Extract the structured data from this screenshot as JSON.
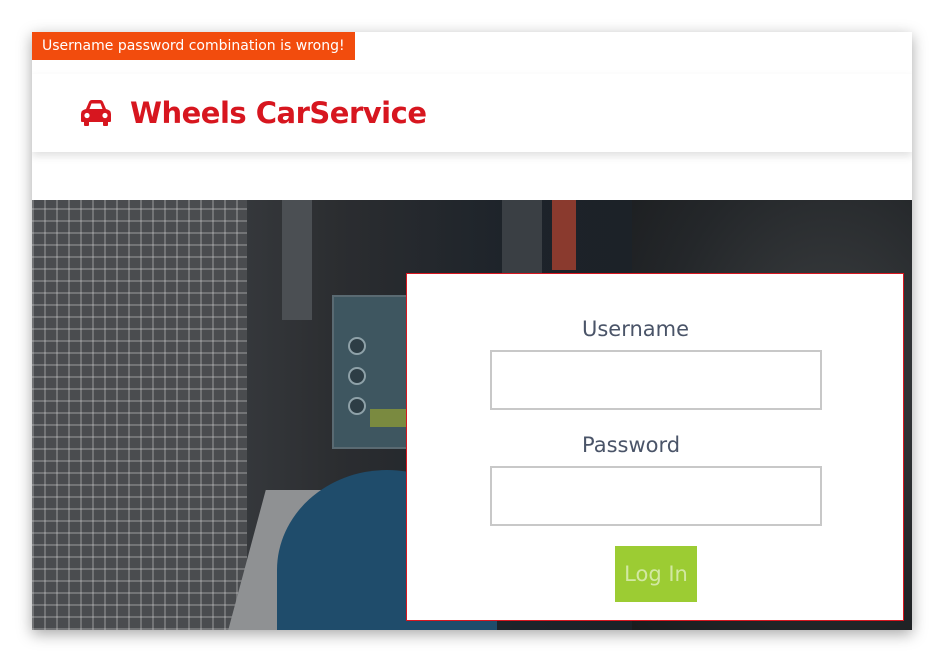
{
  "error_banner": {
    "text": "Username password combination is wrong!",
    "color": "#f24c0d"
  },
  "header": {
    "brand_icon": "car-icon",
    "brand_name": "Wheels CarService",
    "brand_color": "#d7161f"
  },
  "login_form": {
    "username_label": "Username",
    "username_value": "",
    "password_label": "Password",
    "password_value": "",
    "submit_label": "Log In",
    "submit_color": "#9ccc33"
  }
}
